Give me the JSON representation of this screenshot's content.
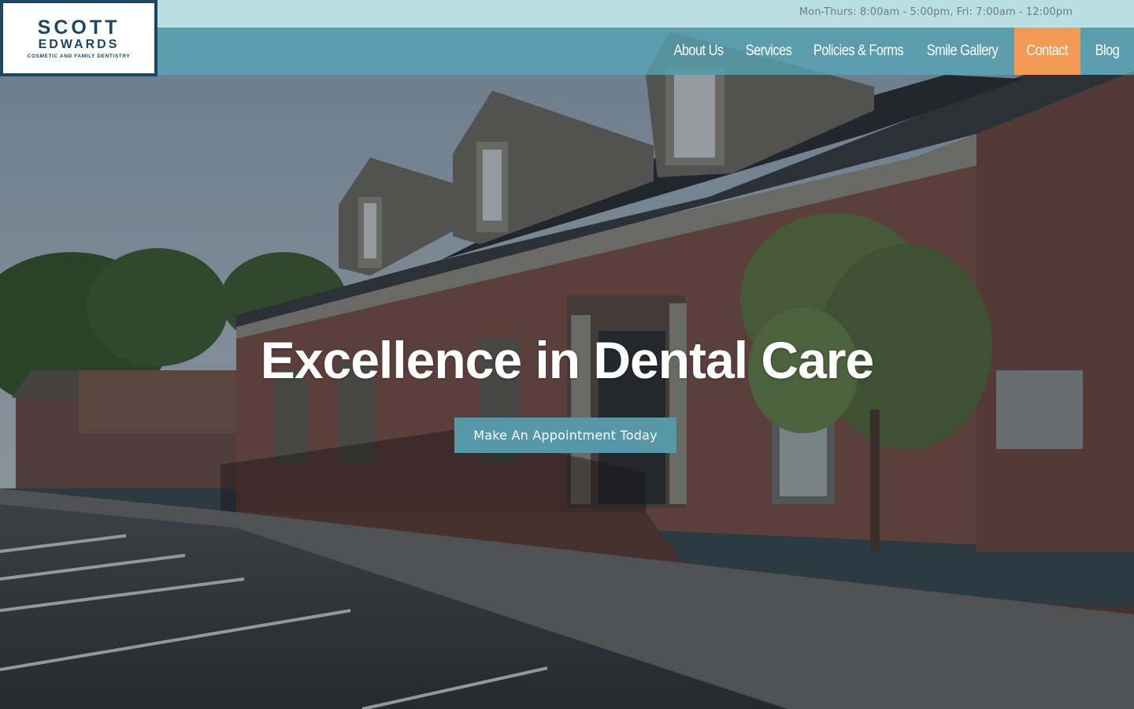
{
  "header": {
    "hours": "Mon-Thurs: 8:00am - 5:00pm, Fri: 7:00am - 12:00pm",
    "logo": {
      "line1": "SCOTT",
      "line2": "EDWARDS",
      "tagline": "COSMETIC AND FAMILY DENTISTRY"
    }
  },
  "nav": {
    "items": [
      {
        "label": "About Us"
      },
      {
        "label": "Services"
      },
      {
        "label": "Policies & Forms"
      },
      {
        "label": "Smile Gallery"
      },
      {
        "label": "Contact",
        "active": true
      },
      {
        "label": "Blog"
      }
    ]
  },
  "hero": {
    "headline": "Excellence in Dental Care",
    "cta_label": "Make An Appointment Today"
  },
  "colors": {
    "topbar": "#b9dfe3",
    "navbar": "#56aaba",
    "accent": "#f39a57",
    "logo_navy": "#1b4666",
    "cta": "#5697a8"
  }
}
